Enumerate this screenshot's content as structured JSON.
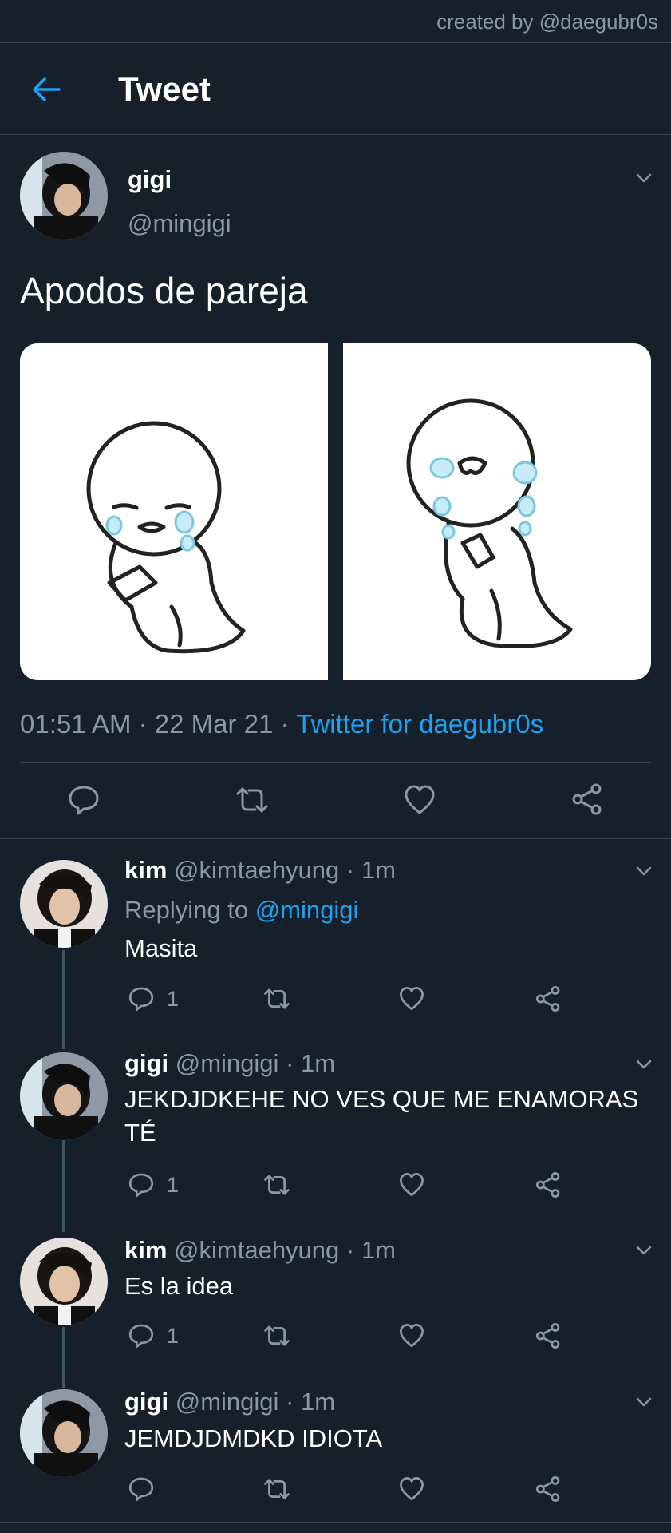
{
  "watermark": "created by @daegubr0s",
  "header": {
    "title": "Tweet"
  },
  "tweet": {
    "name": "gigi",
    "handle": "@mingigi",
    "text": "Apodos de pareja",
    "time": "01:51 AM",
    "sep1": "·",
    "date": "22 Mar 21",
    "sep2": "·",
    "source": "Twitter for daegubr0s"
  },
  "replies": [
    {
      "name": "kim",
      "handle": "@kimtaehyung",
      "time": "· 1m",
      "replying_prefix": "Replying to",
      "replying_handle": "@mingigi",
      "text": "Masita",
      "reply_count": "1"
    },
    {
      "name": "gigi",
      "handle": "@mingigi",
      "time": "· 1m",
      "text_line1": "JEKDJDKEHE NO VES QUE ME ENAMORAS",
      "text_line2": "TÉ",
      "reply_count": "1"
    },
    {
      "name": "kim",
      "handle": "@kimtaehyung",
      "time": "· 1m",
      "text": "Es la idea",
      "reply_count": "1"
    },
    {
      "name": "gigi",
      "handle": "@mingigi",
      "time": "· 1m",
      "text": "JEMDJDMDKD IDIOTA"
    }
  ],
  "colors": {
    "background": "#15202b",
    "accent": "#1da1f2",
    "muted": "#8899a6",
    "divider": "#38444d"
  }
}
